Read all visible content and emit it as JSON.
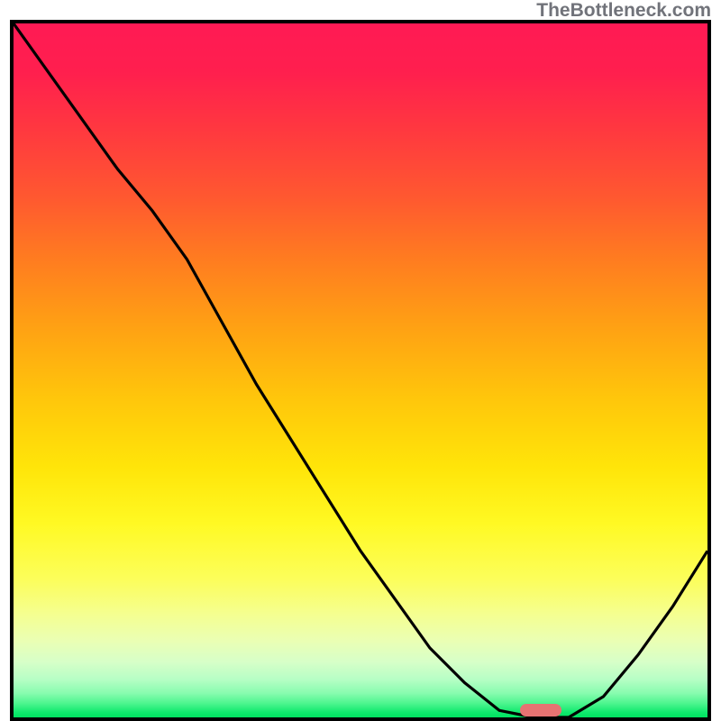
{
  "watermark": "TheBottleneck.com",
  "chart_data": {
    "type": "line",
    "title": "",
    "xlabel": "",
    "ylabel": "",
    "xlim": [
      0,
      100
    ],
    "ylim": [
      0,
      100
    ],
    "x": [
      0,
      5,
      10,
      15,
      20,
      25,
      30,
      35,
      40,
      45,
      50,
      55,
      60,
      65,
      70,
      75,
      80,
      85,
      90,
      95,
      100
    ],
    "values": [
      100,
      93,
      86,
      79,
      73,
      66,
      57,
      48,
      40,
      32,
      24,
      17,
      10,
      5,
      1,
      0,
      0,
      3,
      9,
      16,
      24
    ],
    "marker": {
      "x_from": 73,
      "x_to": 79,
      "y": 1
    },
    "colors": {
      "top": "#ff1a54",
      "mid": "#ffe400",
      "bottom": "#00e261",
      "curve": "#000000",
      "marker": "#e77372",
      "watermark": "#71737a"
    }
  }
}
